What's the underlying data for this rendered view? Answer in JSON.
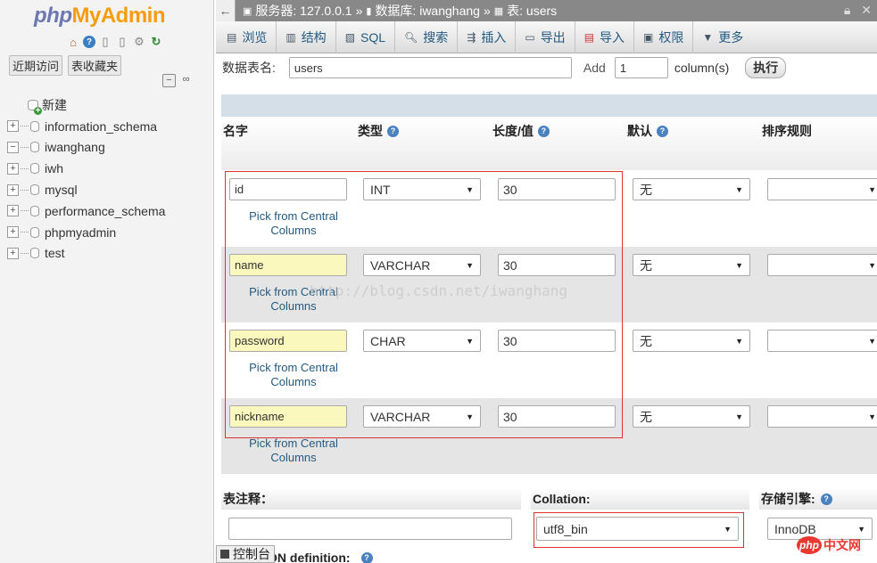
{
  "sidebar": {
    "logo_php": "php",
    "logo_myadmin": "MyAdmin",
    "recent_label": "近期访问",
    "favorites_label": "表收藏夹",
    "new_label": "新建",
    "databases": [
      "information_schema",
      "iwanghang",
      "iwh",
      "mysql",
      "performance_schema",
      "phpmyadmin",
      "test"
    ],
    "expanded_db": "iwanghang"
  },
  "topbar": {
    "server": "服务器: 127.0.0.1",
    "database": "数据库: iwanghang",
    "table": "表: users",
    "sep": "»"
  },
  "tabs": [
    {
      "label": "浏览",
      "icon": "browse-icon"
    },
    {
      "label": "结构",
      "icon": "structure-icon"
    },
    {
      "label": "SQL",
      "icon": "sql-icon"
    },
    {
      "label": "搜索",
      "icon": "search-icon"
    },
    {
      "label": "插入",
      "icon": "insert-icon"
    },
    {
      "label": "导出",
      "icon": "export-icon"
    },
    {
      "label": "导入",
      "icon": "import-icon"
    },
    {
      "label": "权限",
      "icon": "privileges-icon"
    },
    {
      "label": "更多",
      "icon": "chevron-down-icon"
    }
  ],
  "form": {
    "table_name_label": "数据表名:",
    "table_name_value": "users",
    "add_label": "Add",
    "add_count": "1",
    "columns_label": "column(s)",
    "execute_label": "执行"
  },
  "headers": {
    "name": "名字",
    "type": "类型",
    "length": "长度/值",
    "default": "默认",
    "collation": "排序规则"
  },
  "fields": [
    {
      "name": "id",
      "type": "INT",
      "length": "30",
      "default": "无",
      "pick": "Pick from Central Columns"
    },
    {
      "name": "name",
      "type": "VARCHAR",
      "length": "30",
      "default": "无",
      "pick": "Pick from Central Columns"
    },
    {
      "name": "password",
      "type": "CHAR",
      "length": "30",
      "default": "无",
      "pick": "Pick from Central Columns"
    },
    {
      "name": "nickname",
      "type": "VARCHAR",
      "length": "30",
      "default": "无",
      "pick": "Pick from Central Columns"
    }
  ],
  "bottom": {
    "comment_label": "表注释：",
    "collation_label": "Collation:",
    "collation_value": "utf8_bin",
    "engine_label": "存储引擎:",
    "engine_value": "InnoDB",
    "partition_label": "ON definition:"
  },
  "watermark": "http://blog.csdn.net/iwanghang",
  "console_label": "控制台",
  "site_logo": {
    "php": "php",
    "cn": "中文网"
  },
  "colors": {
    "accent": "#235a81",
    "highlight": "#fbf8bd",
    "annotation": "#dd3333"
  }
}
